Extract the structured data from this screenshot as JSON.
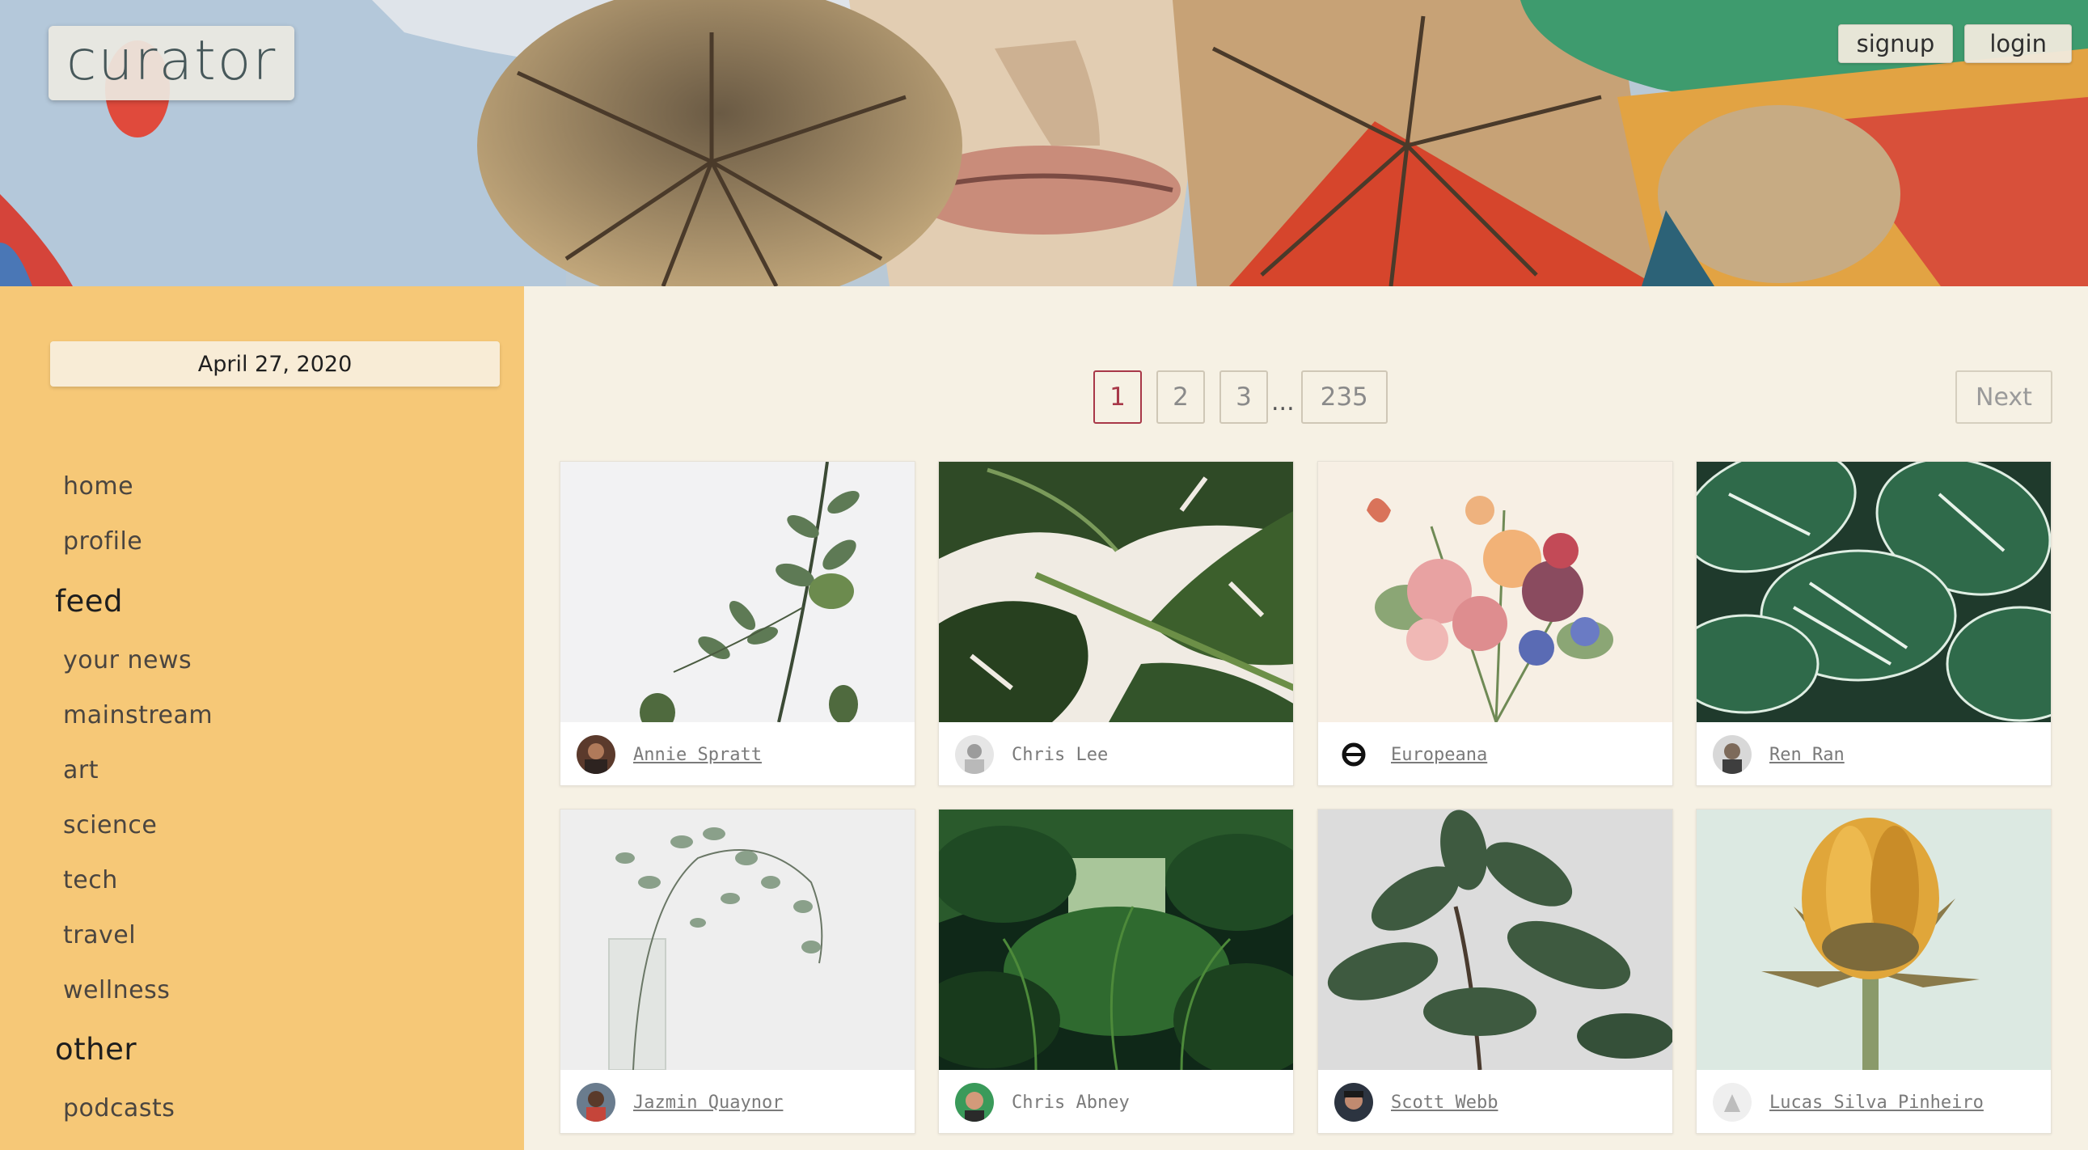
{
  "app": {
    "logo_text": "curator"
  },
  "header": {
    "signup_label": "signup",
    "login_label": "login"
  },
  "sidebar": {
    "date": "April 27, 2020",
    "nav_top": [
      "home",
      "profile"
    ],
    "sections": [
      {
        "heading": "feed",
        "items": [
          "your news",
          "mainstream",
          "art",
          "science",
          "tech",
          "travel",
          "wellness"
        ]
      },
      {
        "heading": "other",
        "items": [
          "podcasts"
        ]
      }
    ]
  },
  "pagination": {
    "pages": [
      "1",
      "2",
      "3"
    ],
    "ellipsis": "...",
    "last_page": "235",
    "current": "1",
    "next_label": "Next"
  },
  "cards": [
    {
      "author": "Annie Spratt",
      "linked": true,
      "photo": "eucalyptus branch on white"
    },
    {
      "author": "Chris Lee",
      "linked": false,
      "photo": "monstera leaves"
    },
    {
      "author": "Europeana",
      "linked": true,
      "photo": "vintage flower bouquet"
    },
    {
      "author": "Ren Ran",
      "linked": true,
      "photo": "striped calathea leaves"
    },
    {
      "author": "Jazmin Quaynor",
      "linked": true,
      "photo": "eucalyptus in glass vase"
    },
    {
      "author": "Chris Abney",
      "linked": false,
      "photo": "greenhouse jungle"
    },
    {
      "author": "Scott Webb",
      "linked": true,
      "photo": "rubber plant"
    },
    {
      "author": "Lucas Silva Pinheiro",
      "linked": true,
      "photo": "yellow sunflower bud"
    }
  ],
  "colors": {
    "sidebar_bg": "#f6c877",
    "main_bg": "#f6f1e4",
    "active_page": "#a83848",
    "logo_text": "#47585a"
  }
}
